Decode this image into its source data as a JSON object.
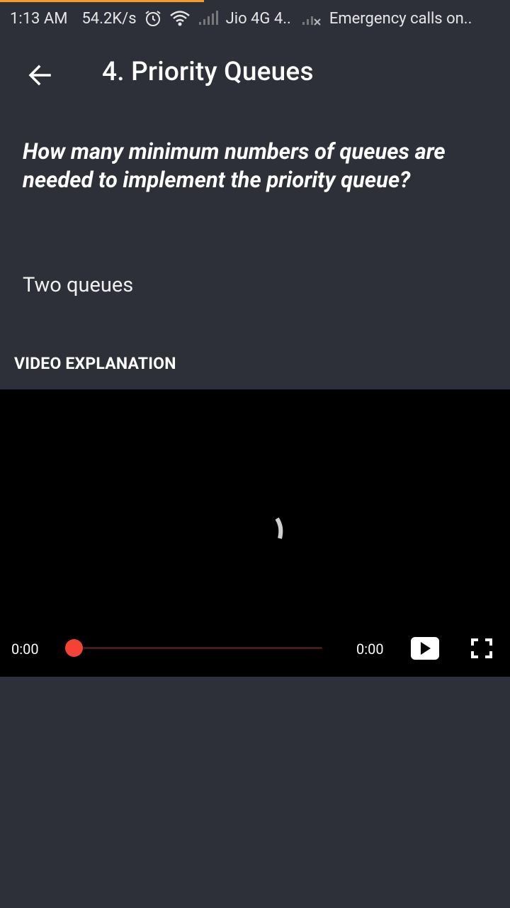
{
  "status_bar": {
    "time": "1:13 AM",
    "speed": "54.2K/s",
    "carrier": "Jio 4G 4..",
    "emergency": "Emergency calls on..",
    "icons": [
      "alarm-icon",
      "wifi-icon",
      "signal-icon",
      "signal-no-service-icon"
    ]
  },
  "app_bar": {
    "title": "4. Priority Queues",
    "back_icon": "arrow-left-icon"
  },
  "content": {
    "question": "How many minimum numbers of queues are needed to implement the priority queue?",
    "answer": "Two queues",
    "section_label": "VIDEO EXPLANATION"
  },
  "video": {
    "current_time": "0:00",
    "duration": "0:00",
    "progress": 0,
    "controls": [
      "play-icon",
      "fullscreen-icon"
    ]
  },
  "colors": {
    "background": "#2d3038",
    "video_bg": "#000000",
    "accent_orange": "#f39c2a",
    "seek_thumb": "#f44336"
  }
}
